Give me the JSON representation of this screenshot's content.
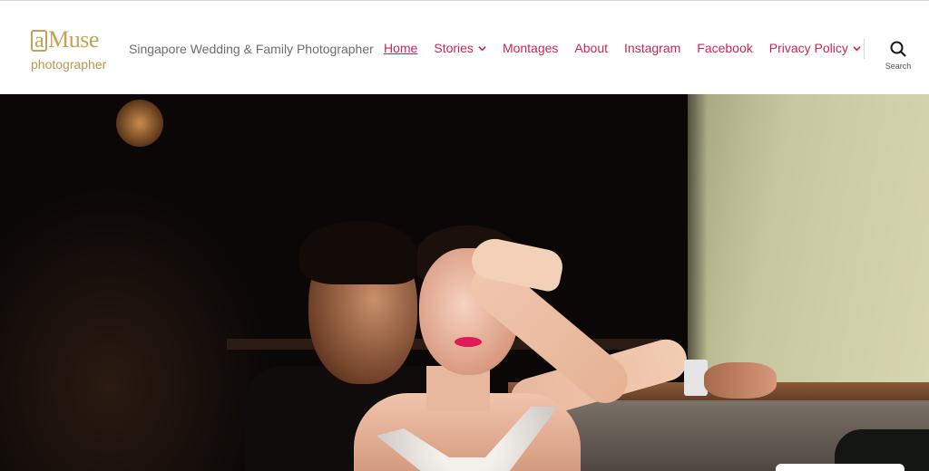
{
  "header": {
    "logo": {
      "top_text": "Muse",
      "top_letter": "a",
      "bottom_text": "photographer"
    },
    "tagline": "Singapore Wedding & Family Photographer",
    "search_label": "Search"
  },
  "nav": {
    "items": [
      {
        "label": "Home",
        "active": true,
        "has_dropdown": false
      },
      {
        "label": "Stories",
        "active": false,
        "has_dropdown": true
      },
      {
        "label": "Montages",
        "active": false,
        "has_dropdown": false
      },
      {
        "label": "About",
        "active": false,
        "has_dropdown": false
      },
      {
        "label": "Instagram",
        "active": false,
        "has_dropdown": false
      },
      {
        "label": "Facebook",
        "active": false,
        "has_dropdown": false
      },
      {
        "label": "Privacy Policy",
        "active": false,
        "has_dropdown": true
      }
    ]
  },
  "colors": {
    "accent": "#cd2653",
    "logo_gold": "#c4a257",
    "tagline": "#6d6d6d"
  },
  "icons": {
    "search": "search-icon",
    "dropdown": "chevron-down-icon"
  }
}
